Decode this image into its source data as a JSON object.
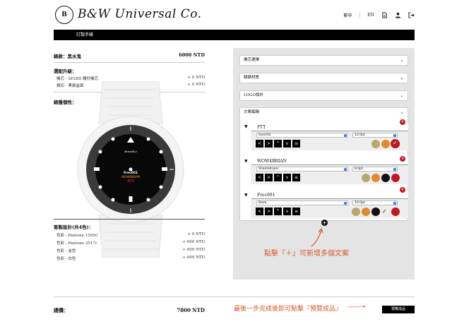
{
  "header": {
    "logo_mark": "B",
    "logo_text": "B&W Universal Co.",
    "lang_tw": "繁中",
    "lang_en": "EN"
  },
  "bar": {
    "title": "訂製手錶"
  },
  "summary": {
    "style_label": "錶款：黑水鬼",
    "style_price": "6000 NTD",
    "upgrade_title": "選配升級：",
    "upgrades": [
      {
        "label": "機芯 - SP28D 鏤秒機芯",
        "price": "+ 0 NTD"
      },
      {
        "label": "錶扣 - 黑錶盒面",
        "price": "+ 0 NTD"
      }
    ],
    "dial_title": "錶盤個性：",
    "design_title": "客製設計(共4色)：",
    "colors": [
      {
        "label": "色彩 - Pantone 1595C",
        "price": "+ 0 NTD"
      },
      {
        "label": "色彩 - Pantone 3517c",
        "price": "+ 600 NTD"
      },
      {
        "label": "色彩 - 金色",
        "price": "+ 600 NTD"
      },
      {
        "label": "色彩 - 白色",
        "price": "+ 600 NTD"
      }
    ],
    "total_label": "總價：",
    "total_price": "7800 NTD"
  },
  "watch": {
    "brand": "BrandLo",
    "line1": "Frec001",
    "line2": "WOW4BRIAN",
    "line3": "PTT"
  },
  "panel": {
    "sections": [
      "機芯選擇",
      "錶錶材質",
      "LOGO設計",
      "文案編輯"
    ],
    "entries": [
      {
        "text": "PTT",
        "font": "Guerilla",
        "size": "12.0pt"
      },
      {
        "text": "WOW4BRIAN",
        "font": "Shantellsans",
        "size": "8.0pt"
      },
      {
        "text": "Frec001",
        "font": "Book",
        "size": "10.0pt"
      }
    ],
    "buttons": [
      "<",
      ">",
      "^",
      "v",
      "≡"
    ],
    "swatches": [
      "#b7a770",
      "#e08a2c",
      "#111111",
      "#c0171f"
    ],
    "check": "✓",
    "close": "×",
    "plus": "+"
  },
  "notes": {
    "add": "點擊『＋』可新增多個文案",
    "preview_hint": "最後一步完成後即可點擊『預覽成品』",
    "arrow": "←——"
  },
  "preview_button": "預覽成品"
}
